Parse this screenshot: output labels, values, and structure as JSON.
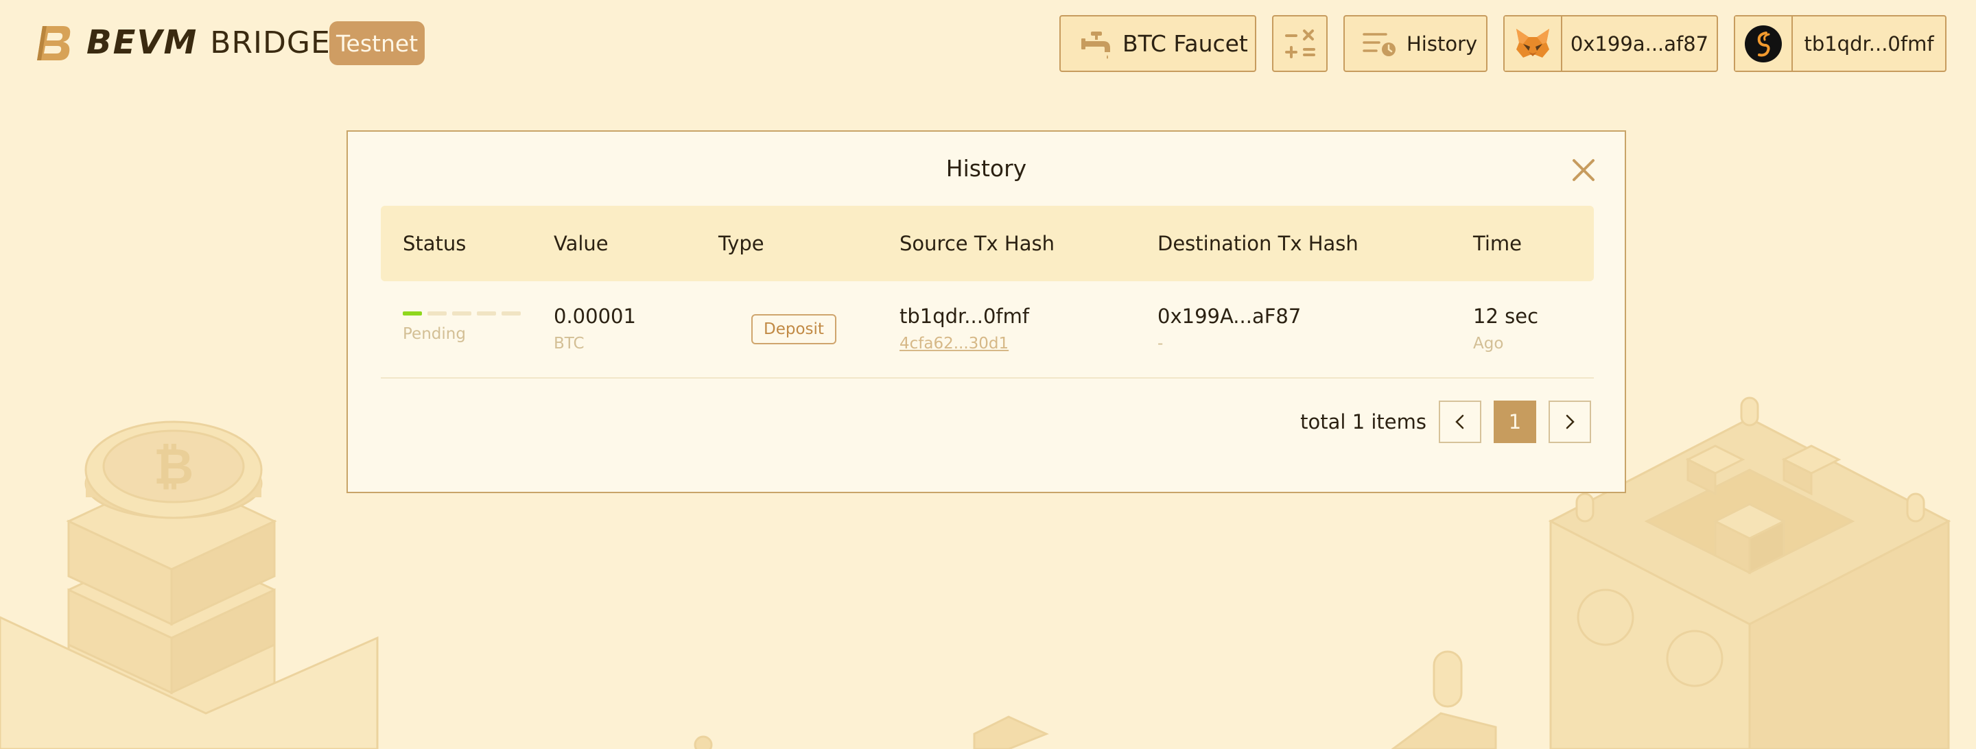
{
  "header": {
    "brand_bevm": "BEVM",
    "brand_bridge": "BRIDGE",
    "network_badge": "Testnet",
    "faucet_label": "BTC Faucet",
    "history_label": "History",
    "evm_wallet": "0x199a...af87",
    "btc_wallet": "tb1qdr...0fmf"
  },
  "modal": {
    "title": "History",
    "columns": [
      "Status",
      "Value",
      "Type",
      "Source Tx Hash",
      "Destination Tx Hash",
      "Time"
    ],
    "rows": [
      {
        "status": "Pending",
        "progress_steps": 5,
        "progress_done": 1,
        "value": "0.00001",
        "unit": "BTC",
        "type": "Deposit",
        "source_addr": "tb1qdr...0fmf",
        "source_tx": "4cfa62...30d1",
        "dest_addr": "0x199A...aF87",
        "dest_tx": "-",
        "time": "12 sec",
        "time_sub": "Ago"
      }
    ],
    "pagination": {
      "total_text": "total 1 items",
      "current_page": "1",
      "prev": "<",
      "next": ">"
    }
  },
  "colors": {
    "background": "#fdf1d3",
    "accent": "#c79c5e",
    "progress_active": "#8fd71e"
  }
}
